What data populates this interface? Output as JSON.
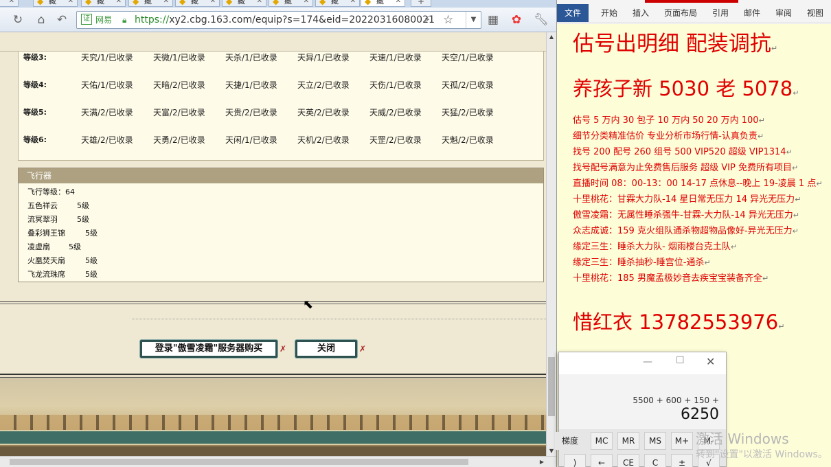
{
  "browser": {
    "tabs": [
      {
        "icon": "folder-icon",
        "label": "藏"
      },
      {
        "icon": "folder-icon",
        "label": "藏"
      },
      {
        "icon": "folder-icon",
        "label": "藏"
      },
      {
        "icon": "folder-icon",
        "label": "藏"
      },
      {
        "icon": "folder-icon",
        "label": "藏"
      },
      {
        "icon": "folder-icon",
        "label": "藏"
      },
      {
        "icon": "folder-icon",
        "label": "藏"
      },
      {
        "icon": "folder-icon",
        "label": "藏"
      }
    ],
    "new_tab_label": "+",
    "site_name": "网易",
    "url_scheme": "https://",
    "url_rest": "xy2.cbg.163.com/equip?s=174&eid=20220316080021",
    "cert_label": "证"
  },
  "skills": {
    "rows": [
      {
        "level": "等级3:",
        "items": [
          "天究/1/已收录",
          "天微/1/已收录",
          "天杀/1/已收录",
          "天异/1/已收录",
          "天速/1/已收录",
          "天空/1/已收录"
        ]
      },
      {
        "level": "等级4:",
        "items": [
          "天佑/1/已收录",
          "天暗/2/已收录",
          "天捷/1/已收录",
          "天立/2/已收录",
          "天伤/1/已收录",
          "天孤/2/已收录"
        ]
      },
      {
        "level": "等级5:",
        "items": [
          "天满/2/已收录",
          "天富/2/已收录",
          "天贵/2/已收录",
          "天英/2/已收录",
          "天威/2/已收录",
          "天猛/2/已收录"
        ]
      },
      {
        "level": "等级6:",
        "items": [
          "天雄/2/已收录",
          "天勇/2/已收录",
          "天闲/1/已收录",
          "天机/2/已收录",
          "天罡/2/已收录",
          "天魁/2/已收录"
        ]
      }
    ]
  },
  "flying": {
    "title": "飞行器",
    "level_text": "飞行等级：64",
    "items": [
      {
        "name": "五色祥云",
        "level": "5级"
      },
      {
        "name": "流冥翠羽",
        "level": "5级"
      },
      {
        "name": "叠彩狮王锦",
        "level": "5级"
      },
      {
        "name": "凌虚扇",
        "level": "5级"
      },
      {
        "name": "火凰焚天扇",
        "level": "5级"
      },
      {
        "name": "飞龙流珠席",
        "level": "5级"
      }
    ]
  },
  "actions": {
    "login_buy": "登录\"傲雪凌霜\"服务器购买",
    "close": "关闭"
  },
  "word": {
    "file_tab": "文件",
    "tabs": [
      "开始",
      "插入",
      "页面布局",
      "引用",
      "邮件",
      "审阅",
      "视图"
    ],
    "lines": [
      "估号出明细 配装调抗",
      "养孩子新 5030 老 5078",
      "估号 5 万内 30 包子  10 万内 50  20 万内 100",
      "细节分类精准估价  专业分析市场行情-认真负责",
      "找号 200   配号 260   组号 500 VIP520   超级 VIP1314",
      "找号配号满意为止免费售后服务   超级 VIP 免费所有项目",
      "直播时间 08：00-13：00 14-17 点休息--晚上 19-凌晨 1 点",
      "十里桃花：甘霖大力队-14 星日常无压力 14 异光无压力",
      "傲雪凌霜：无属性睡杀强牛-甘霖-大力队-14 异光无压力",
      "众志成诚：159 克火组队通杀物超物品像好-异光无压力",
      "缘定三生：睡杀大力队-      烟雨楼台克土队",
      "缘定三生：睡杀抽秒-睡宫位-通杀",
      "十里桃花：185 男魔孟极妙音去疾宝宝装备齐全",
      "惜红衣 13782553976"
    ],
    "para_mark": "↵"
  },
  "calculator": {
    "expression": "5500 + 600 + 150 +",
    "result": "6250",
    "row1": [
      "梯度",
      "MC",
      "MR",
      "MS",
      "M+",
      "M-"
    ],
    "row2": [
      ")",
      "←",
      "CE",
      "C",
      "±",
      "√"
    ],
    "title_min": "—",
    "title_max": "☐",
    "title_close": "✕"
  },
  "watermark": {
    "line1": "激活 Windows",
    "line2": "转到\"设置\"以激活 Windows。"
  }
}
